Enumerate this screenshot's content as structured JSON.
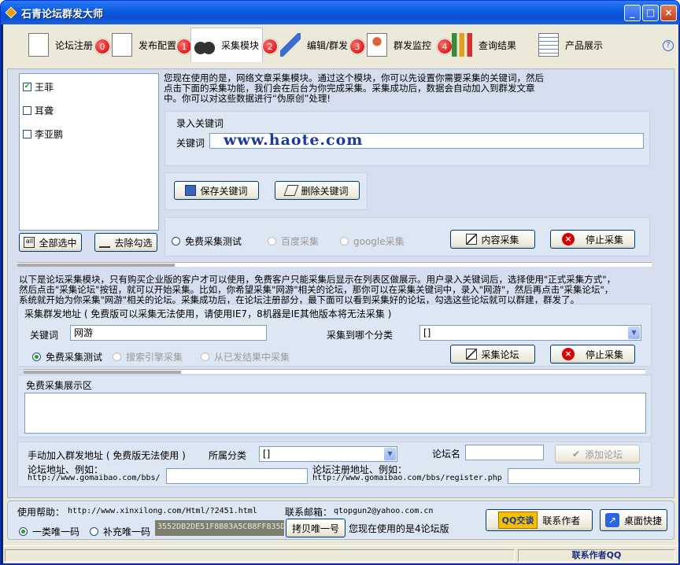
{
  "window": {
    "title": "石青论坛群发大师"
  },
  "toolbar": {
    "items": [
      {
        "label": "论坛注册",
        "badge": "0"
      },
      {
        "label": "发布配置",
        "badge": "1"
      },
      {
        "label": "采集模块",
        "badge": "2"
      },
      {
        "label": "编辑/群发",
        "badge": "3"
      },
      {
        "label": "群发监控",
        "badge": "4"
      },
      {
        "label": "查询结果"
      },
      {
        "label": "产品展示"
      }
    ],
    "help": "?"
  },
  "keywords": {
    "items": [
      {
        "label": "王菲",
        "checked": true
      },
      {
        "label": "耳聋",
        "checked": false
      },
      {
        "label": "李亚鹏",
        "checked": false
      }
    ],
    "select_all": "全部选中",
    "deselect": "去除勾选"
  },
  "article": {
    "desc1": "您现在使用的是，网络文章采集模块。通过这个模块，你可以先设置你需要采集的关键词，然后",
    "desc2": "点击下面的采集功能，我们会在后台为你完成采集。采集成功后，数据会自动加入到群发文章",
    "desc3": "中。你可以对这些数据进行“伪原创”处理!",
    "group_title": "录入关键词",
    "keyword_label": "关键词",
    "watermark": "www.haote.com",
    "save": "保存关键词",
    "delete": "删除关键词",
    "radio_free": "免费采集测试",
    "radio_baidu": "百度采集",
    "radio_google": "google采集",
    "content_collect": "内容采集",
    "stop": "停止采集"
  },
  "forum": {
    "desc1": "以下是论坛采集模块，只有购买企业版的客户才可以使用，免费客户只能采集后显示在列表区做展示。用户录入关键词后，选择使用\"正式采集方式\"，",
    "desc2": "然后点击\"采集论坛\"按钮，就可以开始采集。比如，你希望采集\"网游\"相关的论坛，那你可以在采集关键词中，录入\"网游\"，然后再点击\"采集论坛\"，",
    "desc3": "系统就开始为你采集\"网游\"相关的论坛。采集成功后，在论坛注册部分，最下面可以看到采集好的论坛，勾选这些论坛就可以群建，群发了。",
    "group_title": "采集群发地址 ( 免费版可以采集无法使用，请使用IE7，8机器是IE其他版本将无法采集 )",
    "keyword_label": "关键词",
    "keyword_value": "网游",
    "category_label": "采集到哪个分类",
    "category_value": "[]",
    "radio_free": "免费采集测试",
    "radio_engine": "搜索引擎采集",
    "radio_results": "从已发结果中采集",
    "collect": "采集论坛",
    "stop": "停止采集",
    "display_title": "免费采集展示区"
  },
  "manual": {
    "title": "手动加入群发地址 ( 免费版无法使用 )",
    "category_label": "所属分类",
    "category_value": "[]",
    "name_label": "论坛名",
    "add": "添加论坛",
    "addr_label": "论坛地址、例如：",
    "addr_example": "http://www.gomaibao.com/bbs/",
    "reg_label": "论坛注册地址、例如：",
    "reg_example": "http://www.gomaibao.com/bbs/register.php"
  },
  "footer": {
    "help_label": "使用帮助：",
    "help_url": "http://www.xinxilong.com/Html/?2451.html",
    "email_label": "联系邮箱：",
    "email": "qtopgun2@yahoo.com.cn",
    "radio1": "一类唯一码",
    "radio2": "补充唯一码",
    "serial": "3552DB2DE51F8B83A5CB8FF835D",
    "copy": "拷贝唯一号",
    "version": "您现在使用的是4论坛版",
    "qq": "QQ交谈",
    "contact": "联系作者",
    "desktop": "桌面快捷"
  },
  "status": {
    "right": "联系作者QQ"
  }
}
